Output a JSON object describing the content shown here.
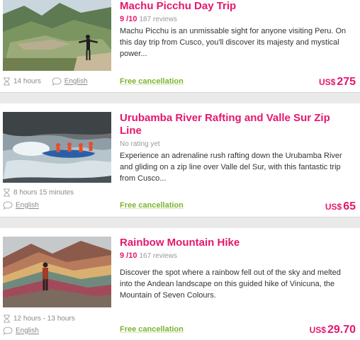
{
  "tours": [
    {
      "title": "Machu Picchu Day Trip",
      "score": "9 /10",
      "reviews": "187 reviews",
      "description": "Machu Picchu is an unmissable sight for anyone visiting Peru. On this day trip from Cusco, you'll discover its majesty and mystical power...",
      "duration": "14 hours",
      "language": "English",
      "cancellation": "Free cancellation",
      "currency": "US$",
      "price": "275"
    },
    {
      "title": "Urubamba River Rafting and Valle Sur Zip Line",
      "rating_text": "No rating yet",
      "description": "Experience an adrenaline rush rafting down the Urubamba River and gliding on a zip line over Valle del Sur, with this fantastic trip from Cusco...",
      "duration": "8 hours 15 minutes",
      "language": "English",
      "cancellation": "Free cancellation",
      "currency": "US$",
      "price": "65"
    },
    {
      "title": "Rainbow Mountain Hike",
      "score": "9 /10",
      "reviews": "167 reviews",
      "description": "Discover the spot where a rainbow fell out of the sky and melted into the Andean landscape on this guided hike of Vinicuna, the Mountain of Seven Colours.",
      "duration": "12 hours - 13 hours",
      "language": "English",
      "cancellation": "Free cancellation",
      "currency": "US$",
      "price": "29.70"
    }
  ],
  "colors": {
    "accent": "#e5176d",
    "green": "#7ab52c",
    "muted": "#999999"
  },
  "icons": {
    "duration": "hourglass-icon",
    "language": "speech-bubble-icon"
  }
}
